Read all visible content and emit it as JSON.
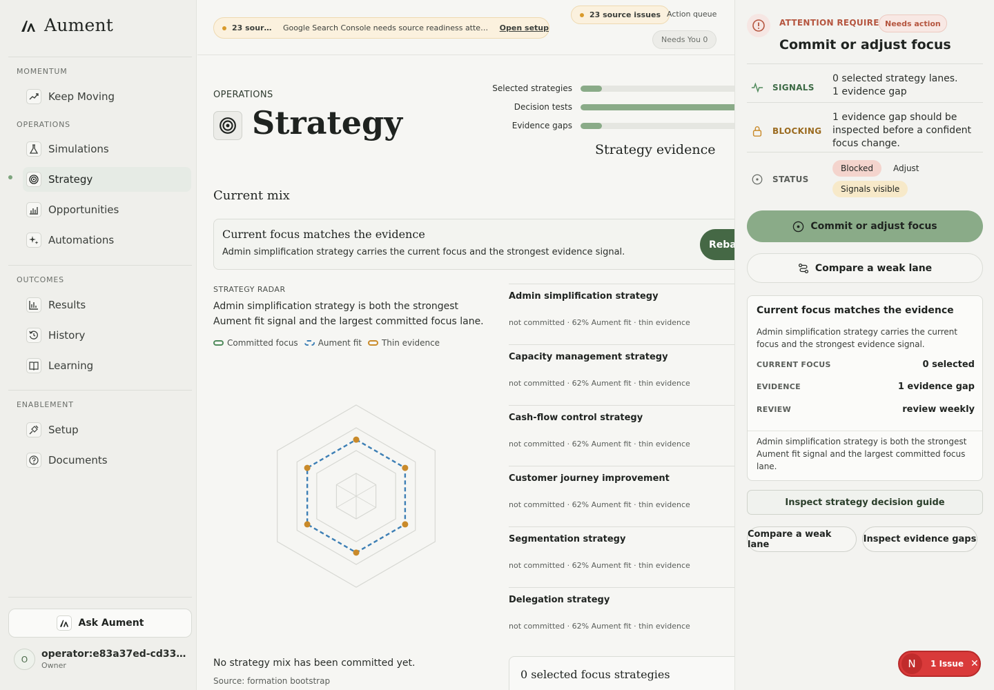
{
  "brand": {
    "name": "Aument"
  },
  "sidebar": {
    "sections": {
      "momentum": "MOMENTUM",
      "operations": "OPERATIONS",
      "outcomes": "OUTCOMES",
      "enablement": "ENABLEMENT"
    },
    "items": {
      "keep_moving": "Keep Moving",
      "simulations": "Simulations",
      "strategy": "Strategy",
      "opportunities": "Opportunities",
      "automations": "Automations",
      "results": "Results",
      "history": "History",
      "learning": "Learning",
      "setup": "Setup",
      "documents": "Documents"
    },
    "ask": "Ask Aument",
    "operator": {
      "initial": "O",
      "name": "operator:e83a37ed-cd33-41…",
      "role": "Owner"
    }
  },
  "topbar": {
    "alert_count": "23 sourc…",
    "alert_message": "Google Search Console needs source readiness attenti…",
    "alert_link": "Open setup",
    "source_issues": "23 source issues",
    "action_queue": "Action queue",
    "needs_you": "Needs You 0"
  },
  "main": {
    "eyebrow": "OPERATIONS",
    "title": "Strategy",
    "evidence": {
      "title": "Strategy evidence",
      "bars": [
        {
          "label": "Selected strategies",
          "fill": 0.12
        },
        {
          "label": "Decision tests",
          "fill": 1.0
        },
        {
          "label": "Evidence gaps",
          "fill": 0.12
        }
      ]
    },
    "mix_title": "Current mix",
    "focus": {
      "title": "Current focus matches the evidence",
      "text": "Admin simplification strategy carries the current focus and the strongest evidence signal.",
      "button": "Rebal"
    },
    "radar": {
      "eyebrow": "STRATEGY RADAR",
      "description": "Admin simplification strategy is both the strongest Aument fit signal and the largest committed focus lane.",
      "legend": [
        "Committed focus",
        "Aument fit",
        "Thin evidence"
      ],
      "colors": {
        "committed": "#4f8a5b",
        "fit": "#3d7fb5",
        "thin": "#c98a2a"
      },
      "values": [
        0.62,
        0.62,
        0.62,
        0.62,
        0.62,
        0.62
      ]
    },
    "lanes": [
      {
        "name": "Admin simplification strategy",
        "meta": "not committed · 62% Aument fit · thin evidence"
      },
      {
        "name": "Capacity management strategy",
        "meta": "not committed · 62% Aument fit · thin evidence"
      },
      {
        "name": "Cash-flow control strategy",
        "meta": "not committed · 62% Aument fit · thin evidence"
      },
      {
        "name": "Customer journey improvement",
        "meta": "not committed · 62% Aument fit · thin evidence"
      },
      {
        "name": "Segmentation strategy",
        "meta": "not committed · 62% Aument fit · thin evidence"
      },
      {
        "name": "Delegation strategy",
        "meta": "not committed · 62% Aument fit · thin evidence"
      }
    ],
    "no_mix": "No strategy mix has been committed yet.",
    "source": "Source: formation bootstrap",
    "selected_box": {
      "title": "0 selected focus strategies"
    }
  },
  "panel": {
    "attention": "ATTENTION REQUIRED",
    "needs_action": "Needs action",
    "title": "Commit or adjust focus",
    "signals": {
      "label": "SIGNALS",
      "line1": "0 selected strategy lanes.",
      "line2": "1 evidence gap"
    },
    "blocking": {
      "label": "BLOCKING",
      "text": "1 evidence gap should be inspected before a confident focus change."
    },
    "status": {
      "label": "STATUS",
      "chips": [
        "Blocked",
        "Adjust",
        "Signals visible"
      ]
    },
    "primary": "Commit or adjust focus",
    "compare": "Compare a weak lane",
    "card": {
      "title": "Current focus matches the evidence",
      "desc": "Admin simplification strategy carries the current focus and the strongest evidence signal.",
      "rows": [
        {
          "k": "CURRENT FOCUS",
          "v": "0 selected"
        },
        {
          "k": "EVIDENCE",
          "v": "1 evidence gap"
        },
        {
          "k": "REVIEW",
          "v": "review weekly"
        }
      ],
      "foot": "Admin simplification strategy is both the strongest Aument fit signal and the largest committed focus lane."
    },
    "guide": "Inspect strategy decision guide",
    "compare_small": "Compare a weak lane",
    "inspect_gaps": "Inspect evidence gaps",
    "colors": {
      "primary": "#8aab88",
      "alert": "#b5553f"
    }
  },
  "issue": {
    "avatar": "N",
    "label": "1 Issue"
  }
}
